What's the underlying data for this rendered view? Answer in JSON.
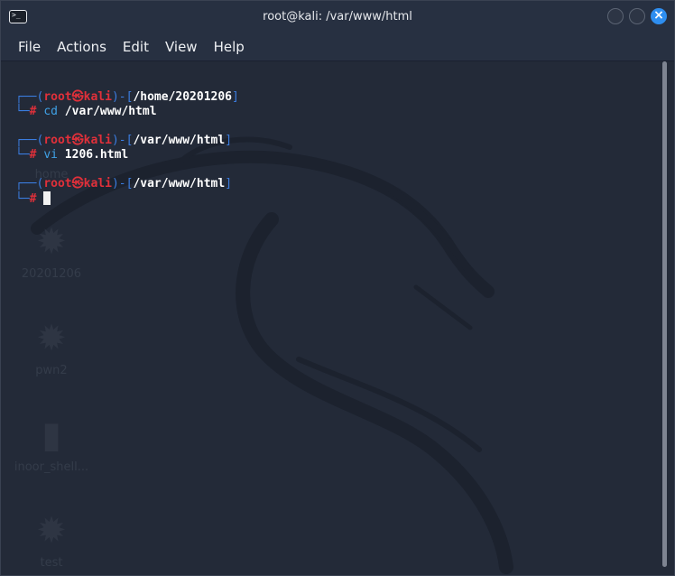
{
  "window": {
    "title": "root@kali: /var/www/html"
  },
  "menu": {
    "items": [
      "File",
      "Actions",
      "Edit",
      "View",
      "Help"
    ]
  },
  "desktop_icons": [
    {
      "label": "home"
    },
    {
      "label": "20201206"
    },
    {
      "label": "pwn2"
    },
    {
      "label": "inoor_shell..."
    },
    {
      "label": "test"
    }
  ],
  "terminal": {
    "user": "root",
    "at_symbol": "㉿",
    "host": "kali",
    "blocks": [
      {
        "path": "/home/20201206",
        "command": "cd",
        "argument": " /var/www/html"
      },
      {
        "path": "/var/www/html",
        "command": "vi",
        "argument": " 1206.html"
      },
      {
        "path": "/var/www/html",
        "command": "",
        "argument": ""
      }
    ]
  }
}
